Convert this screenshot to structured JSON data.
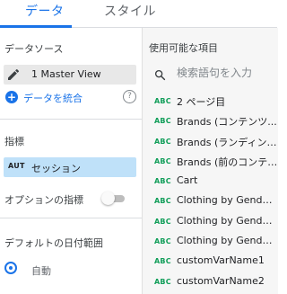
{
  "tabs": {
    "data_label": "データ",
    "style_label": "スタイル"
  },
  "left_panel": {
    "data_source_title": "データソース",
    "data_source_name": "1 Master View",
    "blend_label": "データを統合",
    "metric_title": "指標",
    "metric_type": "AUT",
    "metric_name": "セッション",
    "optional_metrics_label": "オプションの指標",
    "date_range_title": "デフォルトの日付範囲",
    "date_range_option": "自動"
  },
  "right_panel": {
    "title": "使用可能な項目",
    "search_placeholder": "検索語句を入力",
    "field_type": "ABC",
    "fields": [
      "2 ページ目",
      "Brands (コンテンツ...",
      "Brands (ランディング...",
      "Brands (前のコンテン...",
      "Cart",
      "Clothing by Gender (...",
      "Clothing by Gender (...",
      "Clothing by Gender (...",
      "customVarName1",
      "customVarName2"
    ]
  }
}
